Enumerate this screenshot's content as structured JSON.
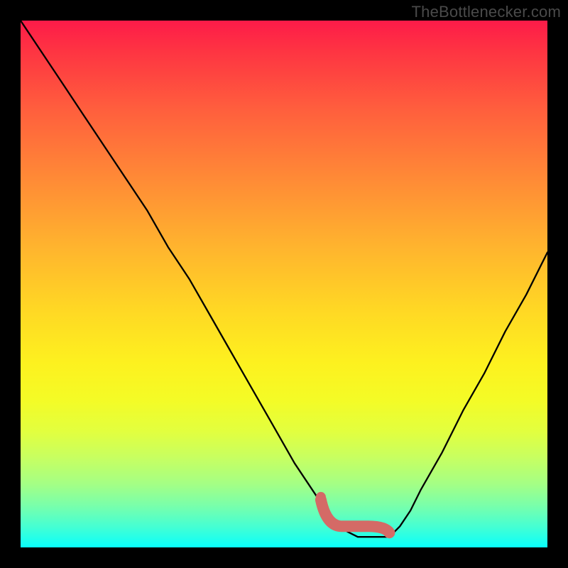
{
  "watermark": "TheBottlenecker.com",
  "colors": {
    "frame": "#000000",
    "watermark_text": "#4a4a4a",
    "curve": "#000000",
    "marker": "#d46a66",
    "gradient_top": "#fd1b49",
    "gradient_bottom": "#09fffb"
  },
  "chart_data": {
    "type": "line",
    "title": "",
    "xlabel": "",
    "ylabel": "",
    "xlim": [
      0,
      100
    ],
    "ylim": [
      0,
      100
    ],
    "annotations": [
      "TheBottlenecker.com"
    ],
    "series": [
      {
        "name": "bottleneck-curve",
        "x": [
          0,
          4,
          8,
          12,
          16,
          20,
          24,
          28,
          32,
          36,
          40,
          44,
          48,
          52,
          56,
          58,
          60,
          62,
          64,
          66,
          68,
          70,
          72,
          74,
          76,
          80,
          84,
          88,
          92,
          96,
          100
        ],
        "values": [
          100,
          94,
          88,
          82,
          76,
          70,
          64,
          57,
          51,
          44,
          37,
          30,
          23,
          16,
          10,
          7,
          5,
          3,
          2,
          2,
          2,
          2,
          4,
          7,
          11,
          18,
          26,
          33,
          41,
          48,
          56
        ]
      }
    ],
    "highlight": {
      "name": "optimal-range-marker",
      "x_range": [
        57,
        70
      ],
      "y": 4
    },
    "legend": null,
    "grid": false
  }
}
